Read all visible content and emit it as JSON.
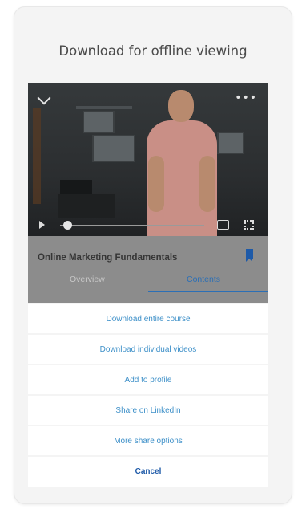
{
  "dialog": {
    "title": "Download for offline viewing"
  },
  "course": {
    "title": "Online Marketing Fundamentals",
    "progress": 0.05,
    "tabs": [
      {
        "label": "Overview",
        "active": false
      },
      {
        "label": "Contents",
        "active": true
      }
    ]
  },
  "options": [
    {
      "label": "Download entire course"
    },
    {
      "label": "Download individual videos"
    },
    {
      "label": "Add to profile"
    },
    {
      "label": "Share on LinkedIn"
    },
    {
      "label": "More share options"
    }
  ],
  "cancel_label": "Cancel",
  "colors": {
    "accent": "#2b6fb6",
    "option_text": "#3c8fc8",
    "card_bg": "#f4f4f4"
  },
  "icons": [
    "chevron-down-icon",
    "more-options-icon",
    "play-icon",
    "captions-icon",
    "fullscreen-icon",
    "bookmark-icon"
  ]
}
